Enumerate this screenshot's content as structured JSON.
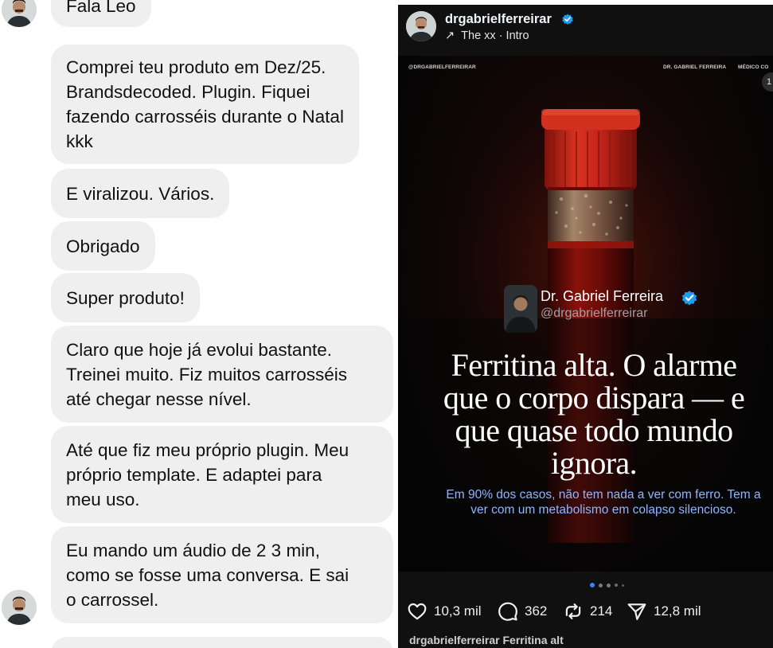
{
  "chat": {
    "messages": [
      {
        "lines": [
          "Fala Leo"
        ]
      },
      {
        "lines": [
          "Comprei teu produto em Dez/25.",
          "Brandsdecoded. Plugin. Fiquei",
          "fazendo carrosséis durante o Natal",
          "kkk"
        ]
      },
      {
        "lines": [
          "E viralizou. Vários."
        ]
      },
      {
        "lines": [
          "Obrigado"
        ]
      },
      {
        "lines": [
          "Super produto!"
        ]
      },
      {
        "lines": [
          "Claro que hoje já evolui bastante.",
          "Treinei muito. Fiz muitos carrosséis",
          "até chegar nesse nível."
        ]
      },
      {
        "lines": [
          "Até que fiz meu próprio plugin. Meu",
          "próprio template. E adaptei para",
          "meu uso."
        ]
      },
      {
        "lines": [
          "Eu mando um áudio de 2 3 min,",
          "como se fosse uma conversa. E sai",
          "o carrossel."
        ]
      }
    ]
  },
  "post": {
    "username": "drgabrielferreirar",
    "music": "The xx · Intro",
    "slide": {
      "top_left": "@DRGABRIELFERREIRAR",
      "top_center": "DR. GABRIEL FERREIRA",
      "top_right": "MÉDICO CO",
      "counter": "1",
      "author_name": "Dr. Gabriel Ferreira",
      "author_handle": "@drgabrielferreirar",
      "headline_lines": [
        "Ferritina alta. O alarme",
        "que o corpo dispara — e",
        "que quase todo mundo",
        "ignora."
      ],
      "subline_lines": [
        "Em 90% dos casos, não tem nada a ver com ferro. Tem a",
        "ver com um metabolismo em colapso silencioso."
      ]
    },
    "pagination": {
      "active_index": 0,
      "dot_count": 5
    },
    "stats": {
      "likes": "10,3 mil",
      "comments": "362",
      "reposts": "214",
      "shares": "12,8 mil"
    },
    "caption_partial": "drgabrielferreirar Ferritina alt",
    "colors": {
      "verified": "#1d9bf0",
      "subline": "#8fb6ff",
      "liquid": "#7a0f0a",
      "cap": "#c4241a",
      "active_dot": "#3b82f6"
    }
  }
}
